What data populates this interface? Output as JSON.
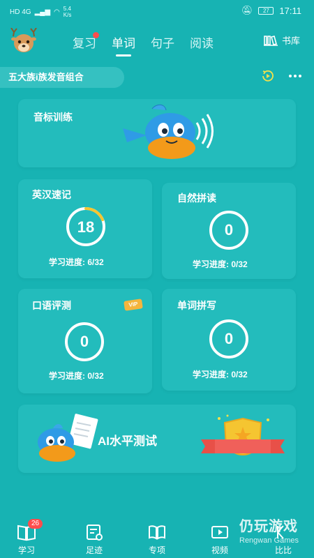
{
  "status_bar": {
    "network": "HD 4G",
    "speed": "5.4\nK/s",
    "battery": "27",
    "time": "17:11"
  },
  "nav": {
    "tabs": [
      {
        "label": "复习",
        "active": false,
        "has_dot": true
      },
      {
        "label": "单词",
        "active": true,
        "has_dot": false
      },
      {
        "label": "句子",
        "active": false,
        "has_dot": false
      },
      {
        "label": "阅读",
        "active": false,
        "has_dot": false
      }
    ],
    "library_label": "书库"
  },
  "course": {
    "title": "五大族i族发音组合"
  },
  "cards": {
    "phonics": {
      "title": "音标训练"
    },
    "memorize": {
      "title": "英汉速记",
      "count": "18",
      "progress_label": "学习进度:",
      "progress_value": "6/32",
      "progress_fraction": 0.1875
    },
    "natural": {
      "title": "自然拼读",
      "count": "0",
      "progress_label": "学习进度:",
      "progress_value": "0/32"
    },
    "oral": {
      "title": "口语评测",
      "vip": "VIP",
      "count": "0",
      "progress_label": "学习进度:",
      "progress_value": "0/32"
    },
    "spelling": {
      "title": "单词拼写",
      "count": "0",
      "progress_label": "学习进度:",
      "progress_value": "0/32"
    },
    "ai_test": {
      "title": "AI水平测试"
    }
  },
  "bottom_nav": {
    "items": [
      {
        "label": "学习",
        "icon": "book-icon",
        "badge": "26"
      },
      {
        "label": "足迹",
        "icon": "calendar-icon"
      },
      {
        "label": "专项",
        "icon": "open-book-icon"
      },
      {
        "label": "视频",
        "icon": "video-icon"
      },
      {
        "label": "比比",
        "icon": "compare-icon"
      }
    ]
  },
  "watermark": {
    "title": "仍玩游戏",
    "subtitle": "Rengwan Games"
  },
  "colors": {
    "background": "#17b3b3",
    "card": "#23bcbc",
    "accent": "#f5c531",
    "badge": "#ff4d4d"
  }
}
